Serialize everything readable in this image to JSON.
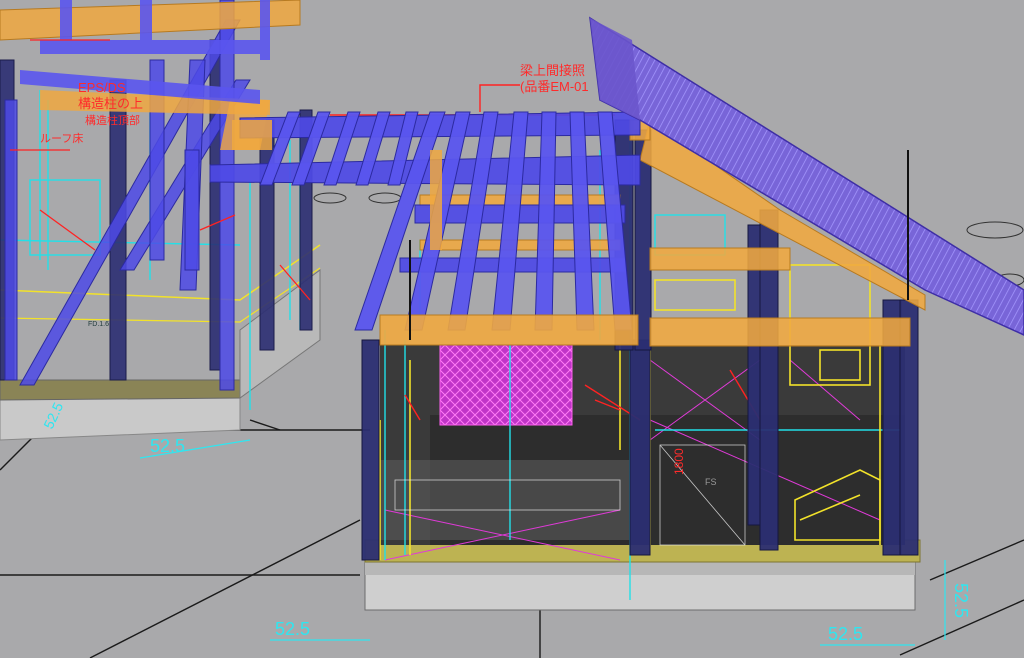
{
  "viewport": {
    "name": "3d-bim-viewport"
  },
  "annotations": {
    "beam_note_line1": "梁上間接照",
    "beam_note_line2": "(品番EM-01",
    "left_note_line1": "EPS/DS",
    "left_note_line2": "構造柱の上",
    "left_note_line3": "構造柱頂部",
    "left_note_line4": "ルーフ床",
    "vertical_dim": "1800"
  },
  "dimensions": {
    "dim_left_mid": "52.5",
    "dim_bottom_left": "52.5",
    "dim_bottom_right": "52.5",
    "dim_right_vertical": "52.5",
    "dim_small_left": "52.5"
  },
  "colors": {
    "background": "#a9a9ab",
    "floor_dark": "#3a3a3a",
    "roof": "#7a62d6",
    "beam_blue": "#4a4be0",
    "beam_orange": "#f0a840",
    "column_navy": "#2b2e72",
    "cyan_line": "#22e0e8",
    "yellow_line": "#f2e22a",
    "magenta_line": "#e03ad8",
    "red_line": "#ff2222"
  }
}
